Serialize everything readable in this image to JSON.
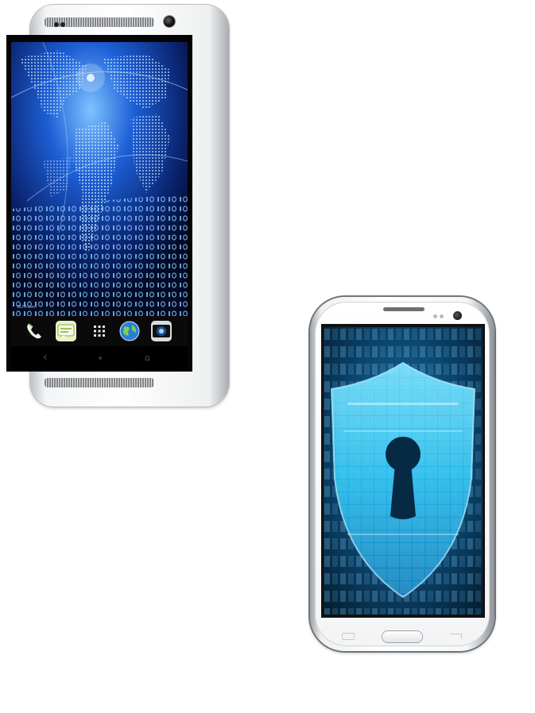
{
  "colors": {
    "background": "#ffffff",
    "phone_body": "#f4f5f6",
    "screen_blue": "#2e7df0",
    "shield_cyan": "#19c4f2"
  },
  "phone1": {
    "dock_icons": [
      "phone-icon",
      "messages-icon",
      "apps-grid-icon",
      "browser-globe-icon",
      "camera-icon"
    ],
    "nav_icons": [
      "back-icon",
      "home-icon"
    ],
    "screen_caption": "ELFA.com"
  },
  "phone2": {
    "screen_icon": "padlock-shield-icon"
  }
}
